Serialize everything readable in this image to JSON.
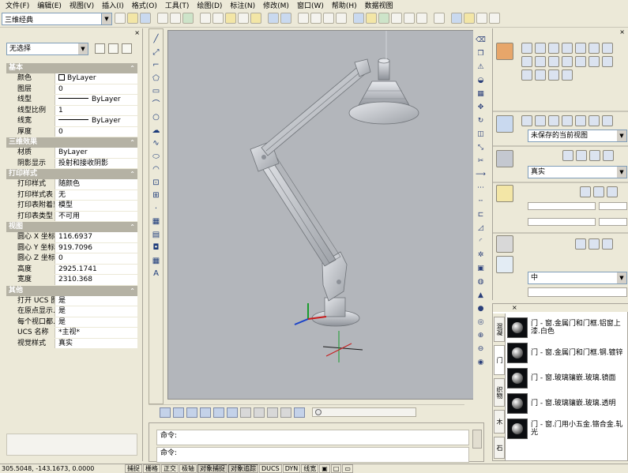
{
  "menu": [
    "文件(F)",
    "编辑(E)",
    "视图(V)",
    "插入(I)",
    "格式(O)",
    "工具(T)",
    "绘图(D)",
    "标注(N)",
    "修改(M)",
    "窗口(W)",
    "帮助(H)",
    "数据视图"
  ],
  "workspace": {
    "value": "三维经典"
  },
  "properties": {
    "selection": "无选择",
    "sections": [
      {
        "title": "基本",
        "rows": [
          {
            "key": "颜色",
            "value": "ByLayer",
            "kind": "color"
          },
          {
            "key": "图层",
            "value": "0"
          },
          {
            "key": "线型",
            "value": "ByLayer",
            "kind": "line"
          },
          {
            "key": "线型比例",
            "value": "1"
          },
          {
            "key": "线宽",
            "value": "ByLayer",
            "kind": "line"
          },
          {
            "key": "厚度",
            "value": "0"
          }
        ]
      },
      {
        "title": "三维效果",
        "rows": [
          {
            "key": "材质",
            "value": "ByLayer"
          },
          {
            "key": "阴影显示",
            "value": "投射和接收阴影"
          }
        ]
      },
      {
        "title": "打印样式",
        "rows": [
          {
            "key": "打印样式",
            "value": "随颜色"
          },
          {
            "key": "打印样式表",
            "value": "无"
          },
          {
            "key": "打印表附着到",
            "value": "模型"
          },
          {
            "key": "打印表类型",
            "value": "不可用"
          }
        ]
      },
      {
        "title": "视图",
        "rows": [
          {
            "key": "圆心 X 坐标",
            "value": "116.6937"
          },
          {
            "key": "圆心 Y 坐标",
            "value": "919.7096"
          },
          {
            "key": "圆心 Z 坐标",
            "value": "0"
          },
          {
            "key": "高度",
            "value": "2925.1741"
          },
          {
            "key": "宽度",
            "value": "2310.368"
          }
        ]
      },
      {
        "title": "其他",
        "rows": [
          {
            "key": "打开 UCS 图标",
            "value": "是"
          },
          {
            "key": "在原点显示...",
            "value": "是"
          },
          {
            "key": "每个视口都...",
            "value": "是"
          },
          {
            "key": "UCS 名称",
            "value": "*主视*"
          },
          {
            "key": "视觉样式",
            "value": "真实"
          }
        ]
      }
    ]
  },
  "dashboard": {
    "view_select": "未保存的当前视图",
    "visual_style": "真实",
    "light_level": "中"
  },
  "palette": {
    "tabs": [
      "混凝",
      "门",
      "织物",
      "木",
      "石"
    ],
    "items": [
      {
        "label": "门 - 窗.金属门和门框.铝窗上漆.白色"
      },
      {
        "label": "门 - 窗.金属门和门框.钢.镀锌"
      },
      {
        "label": "门 - 窗.玻璃镶嵌.玻璃.镜面"
      },
      {
        "label": "门 - 窗.玻璃镶嵌.玻璃.透明"
      },
      {
        "label": "门 - 窗.门用小五金.铬合金.轧光"
      }
    ]
  },
  "command": {
    "line1": "命令:",
    "line2": "命令:"
  },
  "status": {
    "coords": "305.5048, -143.1673, 0.0000",
    "toggles": [
      "捕捉",
      "栅格",
      "正交",
      "极轴",
      "对象捕捉",
      "对象追踪",
      "DUCS",
      "DYN",
      "线宽"
    ]
  }
}
